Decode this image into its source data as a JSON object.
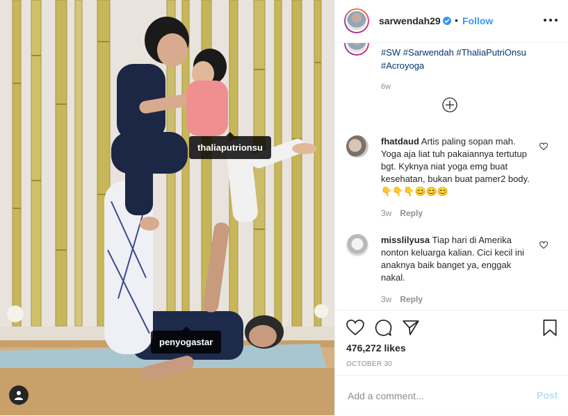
{
  "header": {
    "username": "sarwendah29",
    "separator": "•",
    "follow_label": "Follow"
  },
  "caption": {
    "prefix": "",
    "hashtags": [
      "#SW",
      "#Sarwendah",
      "#ThaliaPutriOnsu",
      "#Acroyoga"
    ],
    "time": "6w"
  },
  "comments": [
    {
      "username": "fhatdaud",
      "text": "Artis paling sopan mah. Yoga aja liat tuh pakaiannya tertutup bgt. Kyknya niat yoga emg buat kesehatan, bukan buat pamer2 body. 👇👇👇😊😊😊",
      "time": "3w",
      "reply_label": "Reply"
    },
    {
      "username": "misslilyusa",
      "text": "Tiap hari di Amerika nonton keluarga kalian. Cici kecil ini anaknya baik banget ya, enggak nakal.",
      "time": "3w",
      "reply_label": "Reply"
    }
  ],
  "photo_tags": {
    "tag1": "thaliaputrionsu",
    "tag2": "penyogastar"
  },
  "actions": {
    "likes": "476,272 likes",
    "date": "OCTOBER 30"
  },
  "add_comment": {
    "placeholder": "Add a comment...",
    "post_label": "Post"
  },
  "colors": {
    "link_blue": "#3897f0",
    "hashtag": "#003569",
    "muted": "#8e8e8e",
    "post_disabled": "#b2dffc"
  },
  "icons": [
    "verified-badge-icon",
    "more-options-icon",
    "load-more-comments-icon",
    "heart-icon",
    "comment-icon",
    "share-icon",
    "bookmark-icon",
    "user-tag-icon"
  ]
}
